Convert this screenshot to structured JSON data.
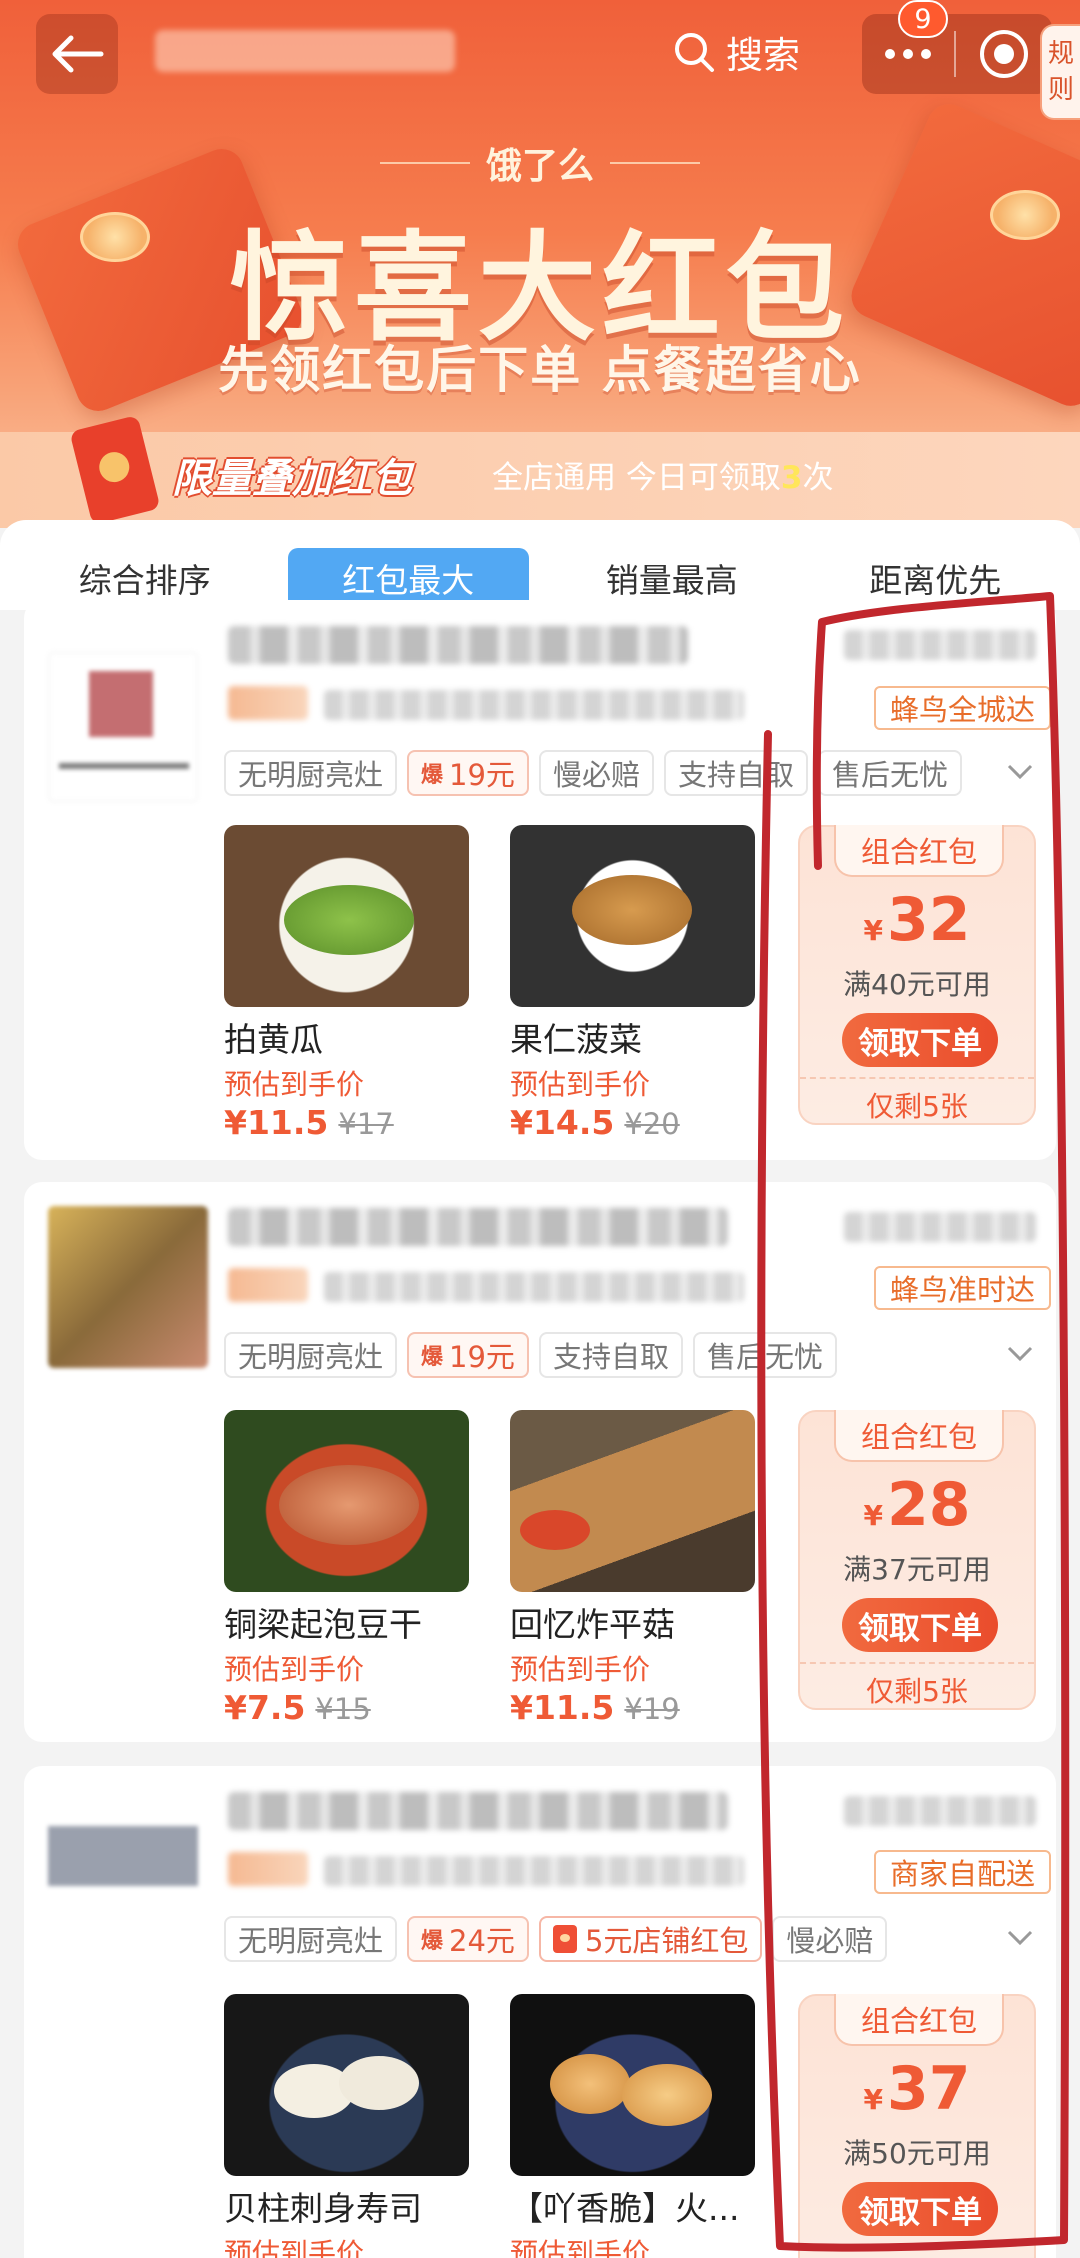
{
  "header": {
    "search_label": "搜索",
    "message_count": "9",
    "rules_label": "规则"
  },
  "banner": {
    "brand": "饿了么",
    "title": "惊喜大红包",
    "subtitle": "先领红包后下单 点餐超省心"
  },
  "promo": {
    "title": "限量叠加红包",
    "desc_prefix": "全店通用 今日可领取",
    "desc_count": "3",
    "desc_suffix": "次"
  },
  "sort_tabs": [
    {
      "label": "综合排序",
      "active": false
    },
    {
      "label": "红包最大",
      "active": true
    },
    {
      "label": "销量最高",
      "active": false
    },
    {
      "label": "距离优先",
      "active": false
    }
  ],
  "shops": [
    {
      "delivery": "蜂鸟全城达",
      "tags": [
        "无明厨亮灶",
        "19元",
        "慢必赔",
        "支持自取",
        "售后无忧"
      ],
      "dishes": [
        {
          "name": "拍黄瓜",
          "est_label": "预估到手价",
          "price": "¥11.5",
          "original": "¥17"
        },
        {
          "name": "果仁菠菜",
          "est_label": "预估到手价",
          "price": "¥14.5",
          "original": "¥20"
        }
      ],
      "coupon": {
        "title": "组合红包",
        "yen": "¥",
        "amount": "32",
        "condition": "满40元可用",
        "button": "领取下单",
        "remaining": "仅剩5张"
      }
    },
    {
      "delivery": "蜂鸟准时达",
      "tags": [
        "无明厨亮灶",
        "19元",
        "支持自取",
        "售后无忧"
      ],
      "dishes": [
        {
          "name": "铜梁起泡豆干",
          "est_label": "预估到手价",
          "price": "¥7.5",
          "original": "¥15"
        },
        {
          "name": "回忆炸平菇",
          "est_label": "预估到手价",
          "price": "¥11.5",
          "original": "¥19"
        }
      ],
      "coupon": {
        "title": "组合红包",
        "yen": "¥",
        "amount": "28",
        "condition": "满37元可用",
        "button": "领取下单",
        "remaining": "仅剩5张"
      }
    },
    {
      "delivery": "商家自配送",
      "tags": [
        "无明厨亮灶",
        "24元",
        "5元店铺红包",
        "慢必赔"
      ],
      "dishes": [
        {
          "name": "贝柱刺身寿司",
          "est_label": "预估到手价"
        },
        {
          "name": "【吖香脆】火...",
          "est_label": "预估到手价"
        }
      ],
      "coupon": {
        "title": "组合红包",
        "yen": "¥",
        "amount": "37",
        "condition": "满50元可用",
        "button": "领取下单"
      }
    }
  ],
  "hot_mark": "爆",
  "colors": {
    "accent": "#ef5a35",
    "tab_active": "#52a8f3",
    "annotation": "#c1272d"
  }
}
